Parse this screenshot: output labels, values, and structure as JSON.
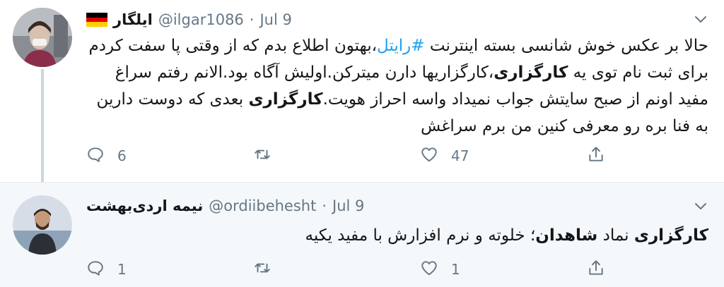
{
  "tweets": [
    {
      "display_name": "ایلگار",
      "flag_icon": "germany-flag-icon",
      "flag_colors": [
        "#000000",
        "#dd0000",
        "#ffce00"
      ],
      "handle": "@ilgar1086",
      "separator": "·",
      "time": "Jul 9",
      "text": {
        "s1": "حالا بر عکس خوش شانسی بسته اینترنت ",
        "hashtag": "#رایتل",
        "s2": "،بهتون اطلاع بدم که از وقتی پا سفت کردم برای ثبت نام توی یه ",
        "b1": "کارگزاری",
        "s3": "،کارگزاریها دارن میترکن.اولیش آگاه بود.الانم رفتم سراغ مفید اونم از صبح سایتش جواب نمیداد واسه احراز هویت.",
        "b2": "کارگزاری",
        "s4": " بعدی که دوست دارین به فنا بره رو معرفی کنین من برم سراغش"
      },
      "replies": "6",
      "retweets": "",
      "likes": "47"
    },
    {
      "display_name": "نیمه اردی‌بهشت",
      "handle": "@ordiibehesht",
      "separator": "·",
      "time": "Jul 9",
      "text": {
        "b1": "کارگزاری",
        "s1": " نماد ",
        "b2": "شاهدان",
        "s2": "؛ خلوته و نرم افزارش با مفید یکیه"
      },
      "replies": "1",
      "retweets": "",
      "likes": "1"
    }
  ],
  "colors": {
    "accent": "#1da1f2",
    "muted": "#657786",
    "text": "#14171a",
    "reply_bg": "#f5f8fa"
  },
  "icons": [
    "reply-icon",
    "retweet-icon",
    "like-icon",
    "share-icon",
    "chevron-down-icon"
  ]
}
